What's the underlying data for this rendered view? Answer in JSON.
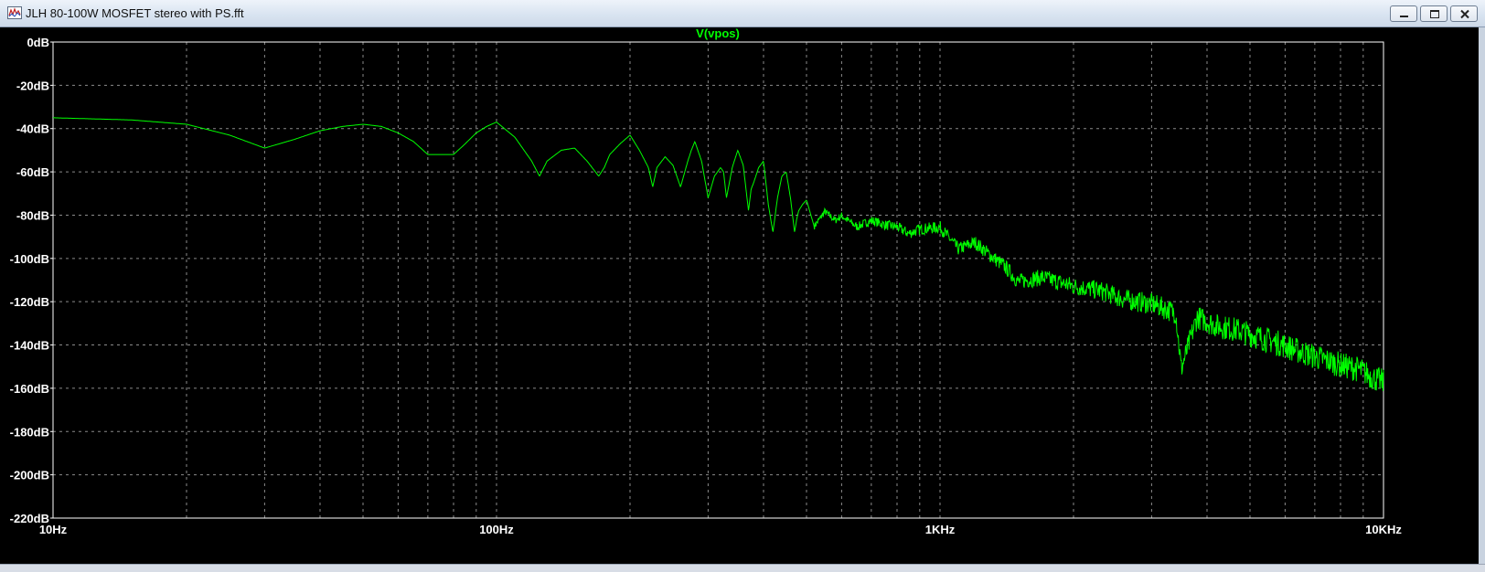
{
  "window": {
    "title": "JLH 80-100W MOSFET stereo with PS.fft",
    "controls": {
      "minimize": "minimize",
      "maximize": "maximize",
      "close": "close"
    }
  },
  "plot": {
    "trace_label": "V(vpos)",
    "trace_color": "#00ff00",
    "grid_color": "#8a8a8a",
    "axis_color": "#ffffff",
    "background": "#000000",
    "y_ticks": [
      "0dB",
      "-20dB",
      "-40dB",
      "-60dB",
      "-80dB",
      "-100dB",
      "-120dB",
      "-140dB",
      "-160dB",
      "-180dB",
      "-200dB",
      "-220dB"
    ],
    "x_ticks": [
      "10Hz",
      "100Hz",
      "1KHz",
      "10KHz"
    ]
  },
  "chart_data": {
    "type": "line",
    "title": "V(vpos)",
    "xlabel": "",
    "ylabel": "",
    "x_scale": "log",
    "xlim": [
      10,
      10000
    ],
    "ylim": [
      -220,
      0
    ],
    "grid": true,
    "series": [
      {
        "name": "V(vpos)",
        "x": [
          10,
          15,
          20,
          25,
          30,
          35,
          40,
          45,
          50,
          55,
          60,
          65,
          70,
          75,
          80,
          85,
          90,
          95,
          100,
          110,
          120,
          125,
          130,
          140,
          150,
          160,
          170,
          175,
          180,
          190,
          200,
          210,
          220,
          225,
          230,
          240,
          250,
          260,
          270,
          275,
          280,
          290,
          300,
          310,
          320,
          325,
          330,
          340,
          350,
          360,
          370,
          375,
          380,
          390,
          400,
          410,
          420,
          425,
          430,
          440,
          450,
          460,
          470,
          475,
          480,
          490,
          500,
          520,
          550,
          580,
          600,
          650,
          700,
          750,
          800,
          850,
          900,
          1000,
          1100,
          1200,
          1300,
          1400,
          1500,
          1700,
          2000,
          2300,
          2600,
          3000,
          3400,
          3500,
          3800,
          4200,
          4700,
          5200,
          5800,
          6500,
          7200,
          8000,
          8800,
          9500,
          10000
        ],
        "values": [
          -35,
          -36,
          -38,
          -43,
          -49,
          -45,
          -41,
          -39,
          -38,
          -39,
          -42,
          -46,
          -52,
          -52,
          -52,
          -47,
          -42,
          -39,
          -37,
          -44,
          -55,
          -62,
          -55,
          -50,
          -49,
          -55,
          -62,
          -58,
          -52,
          -47,
          -43,
          -50,
          -58,
          -67,
          -58,
          -53,
          -57,
          -67,
          -55,
          -50,
          -46,
          -55,
          -72,
          -62,
          -58,
          -60,
          -72,
          -58,
          -50,
          -57,
          -78,
          -68,
          -65,
          -58,
          -55,
          -75,
          -88,
          -80,
          -72,
          -62,
          -60,
          -72,
          -88,
          -82,
          -78,
          -75,
          -73,
          -85,
          -78,
          -82,
          -80,
          -85,
          -82,
          -84,
          -85,
          -88,
          -86,
          -85,
          -95,
          -92,
          -98,
          -103,
          -110,
          -108,
          -112,
          -114,
          -118,
          -120,
          -124,
          -150,
          -126,
          -130,
          -132,
          -135,
          -138,
          -142,
          -145,
          -148,
          -150,
          -154,
          -156
        ]
      }
    ]
  }
}
